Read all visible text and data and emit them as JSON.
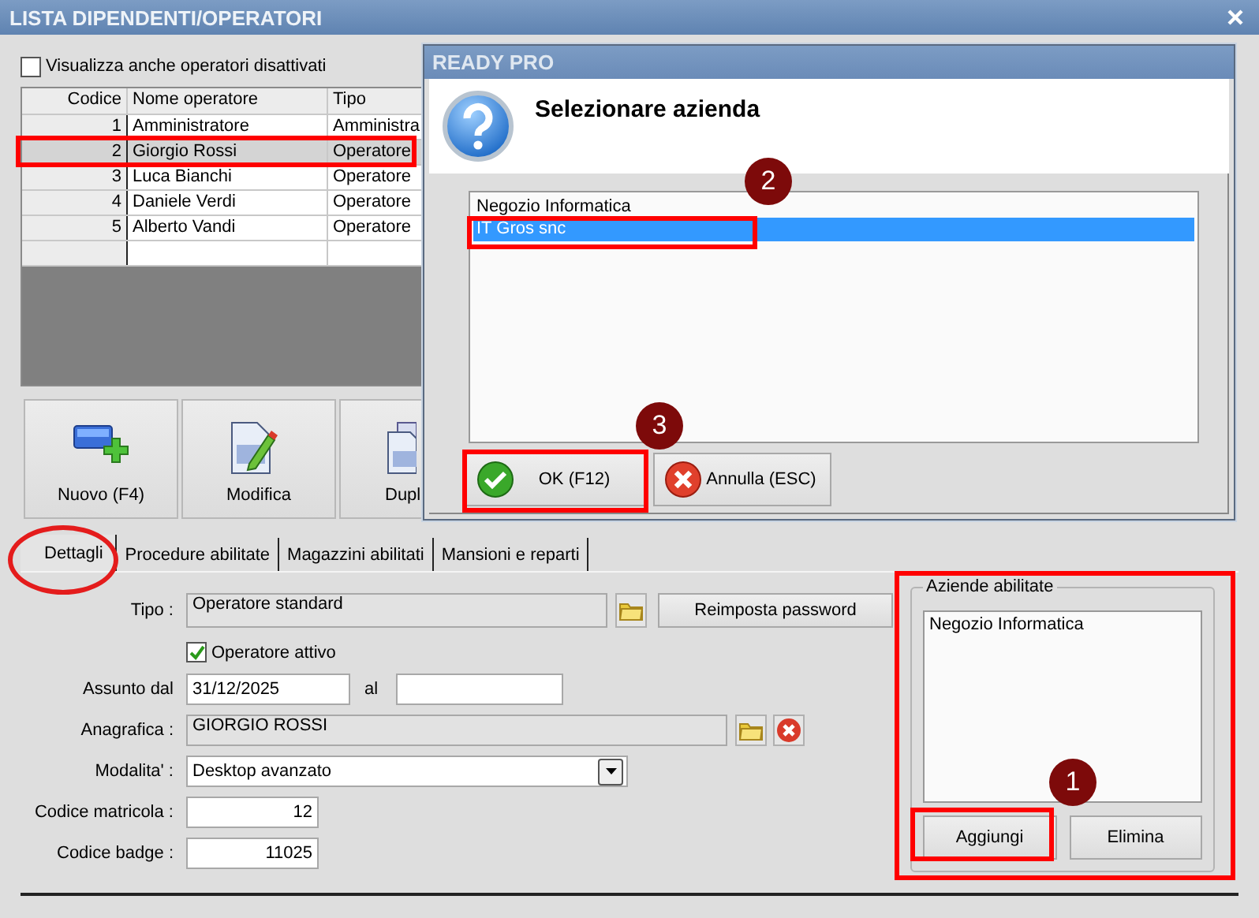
{
  "window": {
    "title": "LISTA DIPENDENTI/OPERATORI"
  },
  "show_disabled": {
    "label": "Visualizza anche operatori disattivati",
    "checked": false
  },
  "table": {
    "columns": [
      "Codice",
      "Nome operatore",
      "Tipo"
    ],
    "rows": [
      {
        "cells": [
          "1",
          "Amministratore",
          "Amministra"
        ],
        "selected": false
      },
      {
        "cells": [
          "2",
          "Giorgio Rossi",
          "Operatore"
        ],
        "selected": true
      },
      {
        "cells": [
          "3",
          "Luca Bianchi",
          "Operatore"
        ],
        "selected": false
      },
      {
        "cells": [
          "4",
          "Daniele Verdi",
          "Operatore"
        ],
        "selected": false
      },
      {
        "cells": [
          "5",
          "Alberto Vandi",
          "Operatore"
        ],
        "selected": false
      }
    ]
  },
  "toolbar": [
    {
      "label": "Nuovo (F4)",
      "kind": "new"
    },
    {
      "label": "Modifica",
      "kind": "edit"
    },
    {
      "label": "Dupl",
      "kind": "duplicate"
    }
  ],
  "tabs": [
    {
      "label": "Dettagli",
      "selected": true
    },
    {
      "label": "Procedure abilitate",
      "selected": false
    },
    {
      "label": "Magazzini abilitati",
      "selected": false
    },
    {
      "label": "Mansioni e reparti",
      "selected": false
    }
  ],
  "details": {
    "tipo": {
      "label": "Tipo :",
      "value": "Operatore standard"
    },
    "reset_password": "Reimposta password",
    "active": {
      "label": "Operatore attivo",
      "checked": true
    },
    "hired_from": {
      "label": "Assunto dal",
      "value": "31/12/2025"
    },
    "hired_to": {
      "label": "al"
    },
    "anagrafica": {
      "label": "Anagrafica :",
      "value": "GIORGIO ROSSI"
    },
    "modalita": {
      "label": "Modalita' :",
      "value": "Desktop avanzato"
    },
    "codice_matricola": {
      "label": "Codice matricola :",
      "value": "12"
    },
    "codice_badge": {
      "label": "Codice badge :",
      "value": "11025"
    }
  },
  "companies": {
    "title": "Aziende abilitate",
    "items": [
      "Negozio Informatica"
    ],
    "buttons": [
      "Aggiungi",
      "Elimina"
    ]
  },
  "dialog": {
    "title": "READY PRO",
    "heading": "Selezionare azienda",
    "items": [
      {
        "label": "Negozio Informatica",
        "selected": false
      },
      {
        "label": "IT Gros snc",
        "selected": true
      }
    ],
    "buttons": [
      {
        "label": "OK (F12)",
        "kind": "ok"
      },
      {
        "label": "Annulla (ESC)",
        "kind": "cancel"
      }
    ]
  },
  "annotations": {
    "badges": [
      "1",
      "2",
      "3"
    ]
  }
}
